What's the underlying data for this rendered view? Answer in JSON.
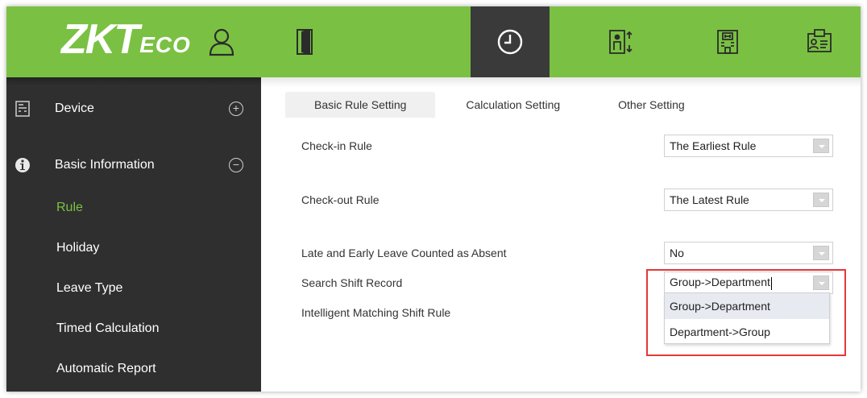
{
  "brand": {
    "logo_main": "ZKT",
    "logo_small": "ECO"
  },
  "modules": [
    {
      "name": "personnel",
      "icon": "person-icon"
    },
    {
      "name": "access",
      "icon": "door-icon"
    },
    {
      "name": "attendance",
      "icon": "clock-icon",
      "active": true
    },
    {
      "name": "elevator",
      "icon": "elevator-icon"
    },
    {
      "name": "hotel",
      "icon": "building-icon"
    },
    {
      "name": "visitor",
      "icon": "id-card-icon"
    }
  ],
  "sidebar": {
    "groups": [
      {
        "label": "Device",
        "icon": "device-icon",
        "toggle": "+"
      },
      {
        "label": "Basic Information",
        "icon": "info-icon",
        "toggle": "−"
      }
    ],
    "items": [
      {
        "label": "Rule",
        "active": true
      },
      {
        "label": "Holiday"
      },
      {
        "label": "Leave Type"
      },
      {
        "label": "Timed Calculation"
      },
      {
        "label": "Automatic Report"
      }
    ]
  },
  "tabs": [
    {
      "label": "Basic Rule Setting",
      "active": true
    },
    {
      "label": "Calculation Setting"
    },
    {
      "label": "Other Setting"
    }
  ],
  "form": {
    "checkin": {
      "label": "Check-in Rule",
      "value": "The Earliest Rule"
    },
    "checkout": {
      "label": "Check-out Rule",
      "value": "The Latest Rule"
    },
    "late_early": {
      "label": "Late and Early Leave Counted as Absent",
      "value": "No"
    },
    "search_shift": {
      "label": "Search Shift Record",
      "value": "Group->Department"
    },
    "intelligent": {
      "label": "Intelligent Matching Shift Rule"
    }
  },
  "dropdown": {
    "options": [
      "Group->Department",
      "Department->Group"
    ],
    "highlighted_index": 0
  },
  "colors": {
    "brand_green": "#7ac143",
    "sidebar_bg": "#2f2f2f",
    "active_module_bg": "#3a3a3a",
    "annotation_red": "#e53935"
  }
}
